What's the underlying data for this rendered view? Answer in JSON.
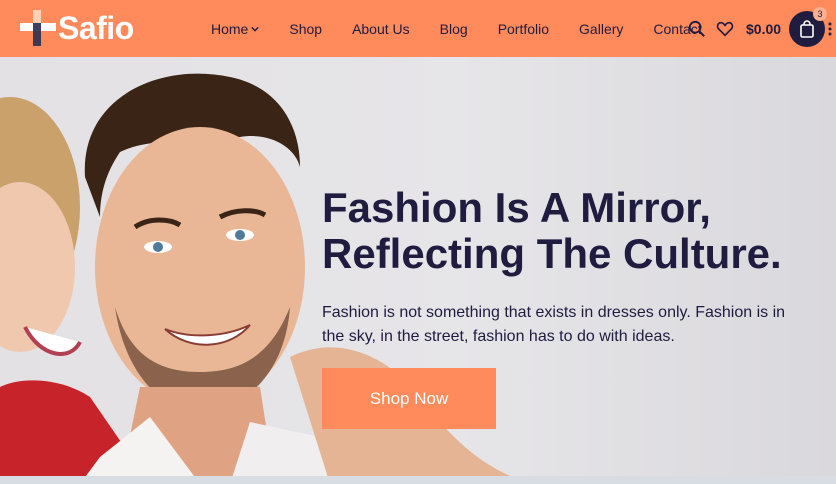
{
  "brand": {
    "name": "Safio"
  },
  "nav": {
    "items": [
      {
        "label": "Home",
        "has_dropdown": true
      },
      {
        "label": "Shop"
      },
      {
        "label": "About Us"
      },
      {
        "label": "Blog"
      },
      {
        "label": "Portfolio"
      },
      {
        "label": "Gallery"
      },
      {
        "label": "Contact"
      }
    ]
  },
  "tools": {
    "search_icon": "search-icon",
    "wishlist_icon": "heart-icon",
    "cart_total": "$0.00",
    "cart_count": "3",
    "cart_icon": "shopping-bag-icon"
  },
  "hero": {
    "headline_line1": "Fashion Is A Mirror,",
    "headline_line2": "Reflecting The Culture.",
    "subtext": "Fashion is not something that exists in dresses only. Fashion is in the sky, in the street, fashion has to do with ideas.",
    "cta_label": "Shop Now"
  },
  "colors": {
    "accent": "#ff8a5c",
    "dark": "#1f1c3f",
    "hero_bg": "#e4e3e6"
  }
}
